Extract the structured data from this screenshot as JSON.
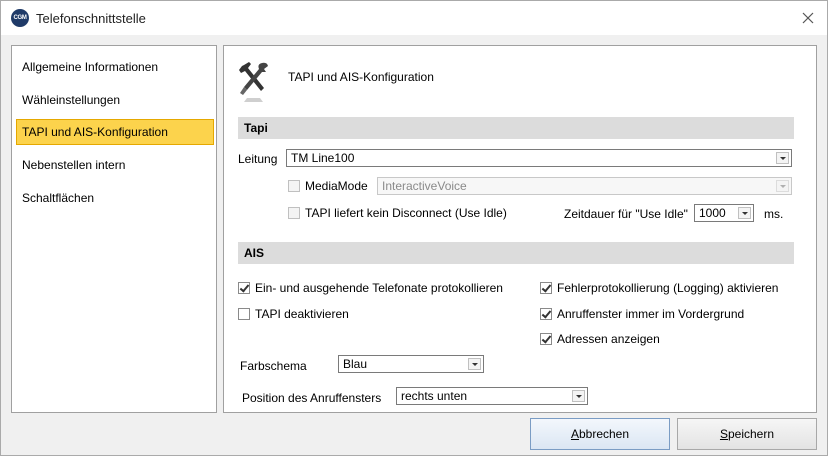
{
  "window": {
    "title": "Telefonschnittstelle",
    "app_icon_text": "CGM"
  },
  "nav": {
    "items": [
      {
        "label": "Allgemeine Informationen",
        "selected": false
      },
      {
        "label": "Wähleinstellungen",
        "selected": false
      },
      {
        "label": "TAPI und AIS-Konfiguration",
        "selected": true
      },
      {
        "label": "Nebenstellen intern",
        "selected": false
      },
      {
        "label": "Schaltflächen",
        "selected": false
      }
    ]
  },
  "content": {
    "title": "TAPI und AIS-Konfiguration",
    "icon": "tools-icon",
    "tapi": {
      "header": "Tapi",
      "leitung_label": "Leitung",
      "leitung_value": "TM Line100",
      "mediamode_label": "MediaMode",
      "mediamode_checked": false,
      "mediamode_value": "InteractiveVoice",
      "use_idle_label": "TAPI liefert kein Disconnect (Use Idle)",
      "use_idle_checked": false,
      "zeitdauer_label": "Zeitdauer für \"Use Idle\"",
      "zeitdauer_value": "1000",
      "zeitdauer_unit": "ms."
    },
    "ais": {
      "header": "AIS",
      "protokollieren_label": "Ein- und ausgehende Telefonate protokollieren",
      "protokollieren_checked": true,
      "tapi_deaktivieren_label": "TAPI deaktivieren",
      "tapi_deaktivieren_checked": false,
      "logging_label": "Fehlerprotokollierung (Logging) aktivieren",
      "logging_checked": true,
      "vordergrund_label": "Anruffenster immer im Vordergrund",
      "vordergrund_checked": true,
      "adressen_label": "Adressen anzeigen",
      "adressen_checked": true,
      "farbschema_label": "Farbschema",
      "farbschema_value": "Blau",
      "position_label": "Position des Anruffensters",
      "position_value": "rechts unten"
    }
  },
  "footer": {
    "cancel": {
      "accel": "A",
      "rest": "bbrechen"
    },
    "save": {
      "accel": "S",
      "rest": "peichern"
    }
  },
  "colors": {
    "selected_bg": "#fcd34c",
    "section_bg": "#dcdcdc",
    "window_bg": "#f0f0f0"
  }
}
